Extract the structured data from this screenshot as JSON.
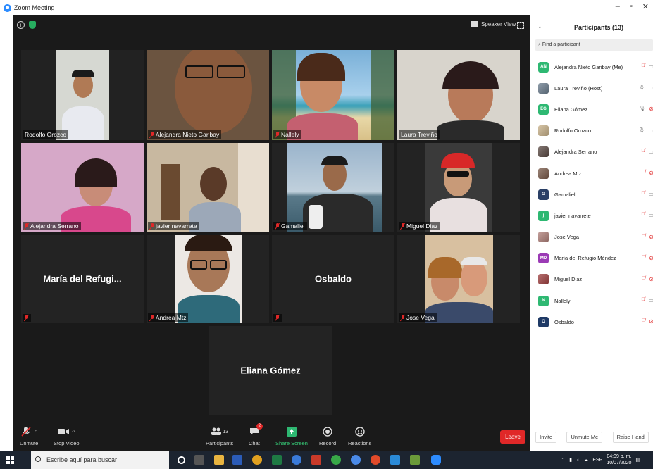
{
  "window": {
    "title": "Zoom Meeting"
  },
  "meeting_controls": {
    "speaker_view_label": "Speaker View"
  },
  "tiles": {
    "rodolfo": "Rodolfo Orozco",
    "alejandra_nieto": "Alejandra Nieto Garibay",
    "nallely": "Nallely",
    "laura": "Laura Treviño",
    "alejandra_serrano": "Alejandra Serrano",
    "javier": "javier navarrete",
    "gamaliel": "Gamaliel",
    "miguel": "Miguel Diaz",
    "maria_big": "María del Refugi...",
    "andrea": "Andrea Mtz",
    "osbaldo_big": "Osbaldo",
    "jose": "Jose Vega",
    "eliana_big": "Eliana Gómez"
  },
  "toolbar": {
    "unmute": "Unmute",
    "stop_video": "Stop Video",
    "participants": "Participants",
    "participants_count": "13",
    "chat": "Chat",
    "chat_badge": "2",
    "share_screen": "Share Screen",
    "record": "Record",
    "reactions": "Reactions",
    "leave": "Leave"
  },
  "panel": {
    "title": "Participants (13)",
    "search_placeholder": "Find a participant",
    "participants": [
      {
        "initials": "AN",
        "name": "Alejandra Nieto Garibay (Me)",
        "color": "#2eb872",
        "mic": "muted",
        "cam": "on"
      },
      {
        "initials": "",
        "name": "Laura Treviño (Host)",
        "color": "#6b7d8e",
        "mic": "on",
        "cam": "on"
      },
      {
        "initials": "EG",
        "name": "Eliana Gómez",
        "color": "#2eb872",
        "mic": "on",
        "cam": "off"
      },
      {
        "initials": "",
        "name": "Rodolfo Orozco",
        "color": "#c9b28a",
        "mic": "on",
        "cam": "on"
      },
      {
        "initials": "",
        "name": "Alejandra Serrano",
        "color": "#5a4a44",
        "mic": "muted",
        "cam": "on"
      },
      {
        "initials": "",
        "name": "Andrea Mtz",
        "color": "#7a5a4a",
        "mic": "muted",
        "cam": "off"
      },
      {
        "initials": "G",
        "name": "Gamaliel",
        "color": "#2a3f66",
        "mic": "muted",
        "cam": "on"
      },
      {
        "initials": "j",
        "name": "javier navarrete",
        "color": "#2eb872",
        "mic": "muted",
        "cam": "on"
      },
      {
        "initials": "",
        "name": "Jose Vega",
        "color": "#b0807a",
        "mic": "muted",
        "cam": "off"
      },
      {
        "initials": "MD",
        "name": "María del Refugio Méndez",
        "color": "#9b3bb5",
        "mic": "muted",
        "cam": "off"
      },
      {
        "initials": "",
        "name": "Miguel Diaz",
        "color": "#a04040",
        "mic": "muted",
        "cam": "off"
      },
      {
        "initials": "N",
        "name": "Nallely",
        "color": "#2eb872",
        "mic": "muted",
        "cam": "on"
      },
      {
        "initials": "O",
        "name": "Osbaldo",
        "color": "#1f3a66",
        "mic": "muted",
        "cam": "off"
      }
    ],
    "invite": "Invite",
    "unmute_me": "Unmute Me",
    "raise_hand": "Raise Hand"
  },
  "taskbar": {
    "search_placeholder": "Escribe aquí para buscar",
    "lang": "ESP",
    "time": "04:09 p. m.",
    "date": "10/07/2020"
  }
}
